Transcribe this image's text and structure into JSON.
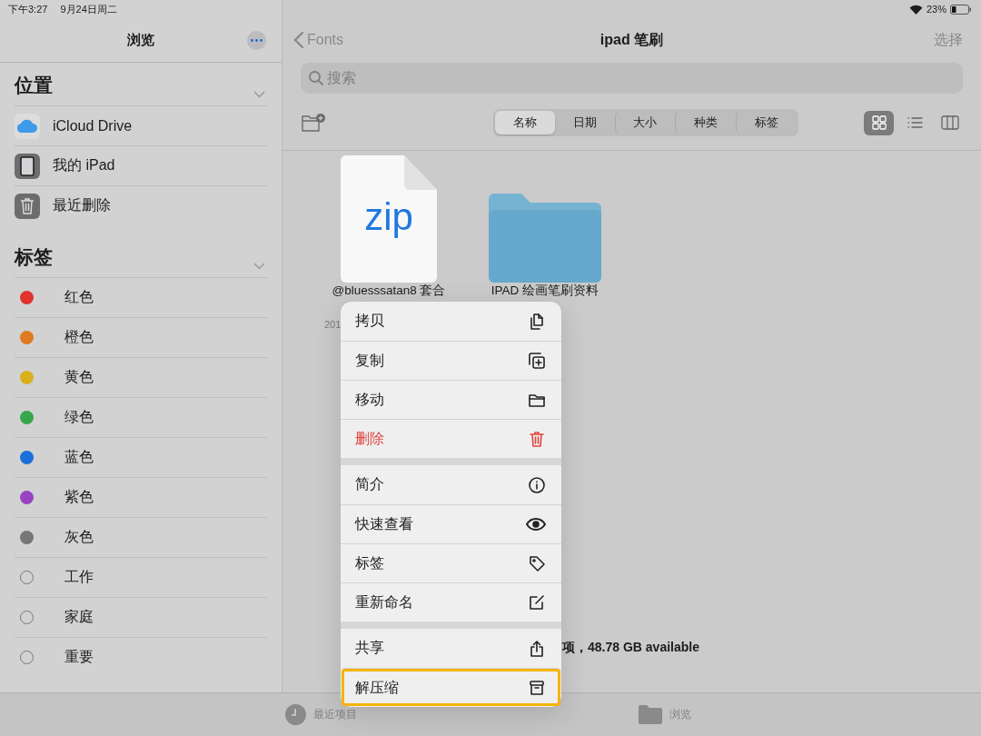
{
  "status_bar": {
    "time": "下午3:27",
    "date": "9月24日周二",
    "battery": "23%"
  },
  "sidebar": {
    "title": "浏览",
    "sections": [
      {
        "title": "位置",
        "items": [
          {
            "kind": "cloud",
            "label": "iCloud Drive"
          },
          {
            "kind": "tablet",
            "label": "我的 iPad"
          },
          {
            "kind": "trash",
            "label": "最近删除"
          }
        ]
      },
      {
        "title": "标签",
        "items": [
          {
            "kind": "tag",
            "label": "红色",
            "color": "#e0322f"
          },
          {
            "kind": "tag",
            "label": "橙色",
            "color": "#de7a1f"
          },
          {
            "kind": "tag",
            "label": "黄色",
            "color": "#d8b01c"
          },
          {
            "kind": "tag",
            "label": "绿色",
            "color": "#38a64a"
          },
          {
            "kind": "tag",
            "label": "蓝色",
            "color": "#1b6fd8"
          },
          {
            "kind": "tag",
            "label": "紫色",
            "color": "#9844c0"
          },
          {
            "kind": "tag",
            "label": "灰色",
            "color": "#77777a"
          },
          {
            "kind": "empty-tag",
            "label": "工作"
          },
          {
            "kind": "empty-tag",
            "label": "家庭"
          },
          {
            "kind": "empty-tag",
            "label": "重要"
          }
        ]
      }
    ]
  },
  "nav": {
    "back": "Fonts",
    "title": "ipad 笔刷",
    "action": "选择"
  },
  "search": {
    "placeholder": "搜索"
  },
  "sort_tabs": [
    {
      "label": "名称",
      "selected": true
    },
    {
      "label": "日期",
      "selected": false
    },
    {
      "label": "大小",
      "selected": false
    },
    {
      "label": "种类",
      "selected": false
    },
    {
      "label": "标签",
      "selected": false
    }
  ],
  "view_modes": [
    {
      "kind": "grid",
      "selected": true
    },
    {
      "kind": "list",
      "selected": false
    },
    {
      "kind": "columns",
      "selected": false
    }
  ],
  "files": [
    {
      "kind": "document",
      "type_label": "zip",
      "name": "@bluesssatan8 套合",
      "date": "201"
    },
    {
      "kind": "folder",
      "name": "IPAD 绘画笔刷资料"
    }
  ],
  "storage": "项，48.78 GB available",
  "context_menu": [
    [
      {
        "kind": "copy",
        "label": "拷贝",
        "destructive": false,
        "highlighted": false
      },
      {
        "kind": "duplicate",
        "label": "复制",
        "destructive": false,
        "highlighted": false
      },
      {
        "kind": "move",
        "label": "移动",
        "destructive": false,
        "highlighted": false
      },
      {
        "kind": "delete",
        "label": "删除",
        "destructive": true,
        "highlighted": false
      }
    ],
    [
      {
        "kind": "info",
        "label": "简介",
        "destructive": false,
        "highlighted": false
      },
      {
        "kind": "preview",
        "label": "快速查看",
        "destructive": false,
        "highlighted": false
      },
      {
        "kind": "tags",
        "label": "标签",
        "destructive": false,
        "highlighted": false
      },
      {
        "kind": "rename",
        "label": "重新命名",
        "destructive": false,
        "highlighted": false
      }
    ],
    [
      {
        "kind": "share",
        "label": "共享",
        "destructive": false,
        "highlighted": false
      },
      {
        "kind": "uncompress",
        "label": "解压缩",
        "destructive": false,
        "highlighted": true
      }
    ]
  ],
  "tab_bar": [
    {
      "kind": "recents",
      "label": "最近项目",
      "selected": false
    },
    {
      "kind": "browse",
      "label": "浏览",
      "selected": false
    }
  ]
}
